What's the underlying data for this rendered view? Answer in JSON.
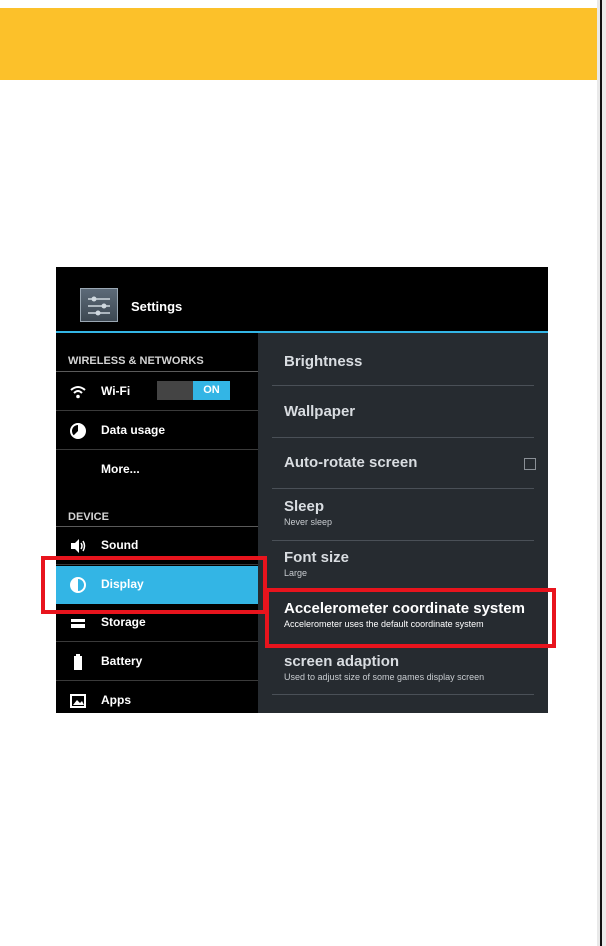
{
  "app": {
    "title": "Settings",
    "icon": "settings-sliders-icon",
    "accent_color": "#33b5e5"
  },
  "banner": {
    "color": "#fcc12a"
  },
  "left_pane": {
    "sections": [
      {
        "header": "WIRELESS & NETWORKS"
      },
      {
        "header": "DEVICE"
      }
    ],
    "items": [
      {
        "label": "Wi-Fi",
        "icon": "wifi-icon",
        "toggle": "ON"
      },
      {
        "label": "Data usage",
        "icon": "data-usage-icon"
      },
      {
        "label": "More...",
        "icon": ""
      },
      {
        "label": "Sound",
        "icon": "speaker-icon"
      },
      {
        "label": "Display",
        "icon": "display-icon",
        "selected": true
      },
      {
        "label": "Storage",
        "icon": "storage-icon"
      },
      {
        "label": "Battery",
        "icon": "battery-icon"
      },
      {
        "label": "Apps",
        "icon": "apps-icon"
      }
    ]
  },
  "right_pane": {
    "items": [
      {
        "title": "Brightness",
        "subtitle": ""
      },
      {
        "title": "Wallpaper",
        "subtitle": ""
      },
      {
        "title": "Auto-rotate screen",
        "subtitle": "",
        "checkbox_checked": false
      },
      {
        "title": "Sleep",
        "subtitle": "Never sleep"
      },
      {
        "title": "Font size",
        "subtitle": "Large"
      },
      {
        "title": "Accelerometer coordinate system",
        "subtitle": "Accelerometer uses the default coordinate system"
      },
      {
        "title": "screen adaption",
        "subtitle": "Used to adjust size of some games display screen"
      }
    ]
  },
  "highlights": {
    "color": "#e8141d"
  }
}
